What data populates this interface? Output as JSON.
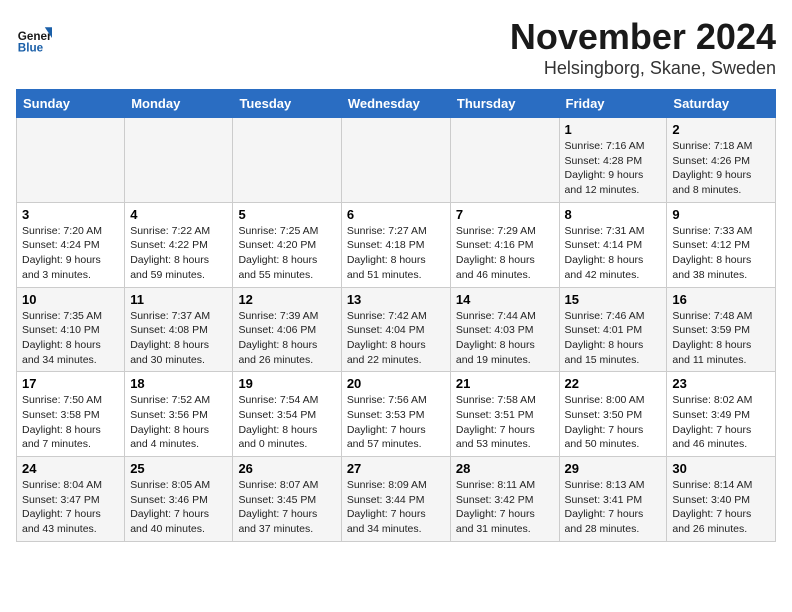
{
  "header": {
    "logo_text_general": "General",
    "logo_text_blue": "Blue",
    "title": "November 2024",
    "subtitle": "Helsingborg, Skane, Sweden"
  },
  "weekdays": [
    "Sunday",
    "Monday",
    "Tuesday",
    "Wednesday",
    "Thursday",
    "Friday",
    "Saturday"
  ],
  "weeks": [
    [
      {
        "day": "",
        "info": ""
      },
      {
        "day": "",
        "info": ""
      },
      {
        "day": "",
        "info": ""
      },
      {
        "day": "",
        "info": ""
      },
      {
        "day": "",
        "info": ""
      },
      {
        "day": "1",
        "info": "Sunrise: 7:16 AM\nSunset: 4:28 PM\nDaylight: 9 hours\nand 12 minutes."
      },
      {
        "day": "2",
        "info": "Sunrise: 7:18 AM\nSunset: 4:26 PM\nDaylight: 9 hours\nand 8 minutes."
      }
    ],
    [
      {
        "day": "3",
        "info": "Sunrise: 7:20 AM\nSunset: 4:24 PM\nDaylight: 9 hours\nand 3 minutes."
      },
      {
        "day": "4",
        "info": "Sunrise: 7:22 AM\nSunset: 4:22 PM\nDaylight: 8 hours\nand 59 minutes."
      },
      {
        "day": "5",
        "info": "Sunrise: 7:25 AM\nSunset: 4:20 PM\nDaylight: 8 hours\nand 55 minutes."
      },
      {
        "day": "6",
        "info": "Sunrise: 7:27 AM\nSunset: 4:18 PM\nDaylight: 8 hours\nand 51 minutes."
      },
      {
        "day": "7",
        "info": "Sunrise: 7:29 AM\nSunset: 4:16 PM\nDaylight: 8 hours\nand 46 minutes."
      },
      {
        "day": "8",
        "info": "Sunrise: 7:31 AM\nSunset: 4:14 PM\nDaylight: 8 hours\nand 42 minutes."
      },
      {
        "day": "9",
        "info": "Sunrise: 7:33 AM\nSunset: 4:12 PM\nDaylight: 8 hours\nand 38 minutes."
      }
    ],
    [
      {
        "day": "10",
        "info": "Sunrise: 7:35 AM\nSunset: 4:10 PM\nDaylight: 8 hours\nand 34 minutes."
      },
      {
        "day": "11",
        "info": "Sunrise: 7:37 AM\nSunset: 4:08 PM\nDaylight: 8 hours\nand 30 minutes."
      },
      {
        "day": "12",
        "info": "Sunrise: 7:39 AM\nSunset: 4:06 PM\nDaylight: 8 hours\nand 26 minutes."
      },
      {
        "day": "13",
        "info": "Sunrise: 7:42 AM\nSunset: 4:04 PM\nDaylight: 8 hours\nand 22 minutes."
      },
      {
        "day": "14",
        "info": "Sunrise: 7:44 AM\nSunset: 4:03 PM\nDaylight: 8 hours\nand 19 minutes."
      },
      {
        "day": "15",
        "info": "Sunrise: 7:46 AM\nSunset: 4:01 PM\nDaylight: 8 hours\nand 15 minutes."
      },
      {
        "day": "16",
        "info": "Sunrise: 7:48 AM\nSunset: 3:59 PM\nDaylight: 8 hours\nand 11 minutes."
      }
    ],
    [
      {
        "day": "17",
        "info": "Sunrise: 7:50 AM\nSunset: 3:58 PM\nDaylight: 8 hours\nand 7 minutes."
      },
      {
        "day": "18",
        "info": "Sunrise: 7:52 AM\nSunset: 3:56 PM\nDaylight: 8 hours\nand 4 minutes."
      },
      {
        "day": "19",
        "info": "Sunrise: 7:54 AM\nSunset: 3:54 PM\nDaylight: 8 hours\nand 0 minutes."
      },
      {
        "day": "20",
        "info": "Sunrise: 7:56 AM\nSunset: 3:53 PM\nDaylight: 7 hours\nand 57 minutes."
      },
      {
        "day": "21",
        "info": "Sunrise: 7:58 AM\nSunset: 3:51 PM\nDaylight: 7 hours\nand 53 minutes."
      },
      {
        "day": "22",
        "info": "Sunrise: 8:00 AM\nSunset: 3:50 PM\nDaylight: 7 hours\nand 50 minutes."
      },
      {
        "day": "23",
        "info": "Sunrise: 8:02 AM\nSunset: 3:49 PM\nDaylight: 7 hours\nand 46 minutes."
      }
    ],
    [
      {
        "day": "24",
        "info": "Sunrise: 8:04 AM\nSunset: 3:47 PM\nDaylight: 7 hours\nand 43 minutes."
      },
      {
        "day": "25",
        "info": "Sunrise: 8:05 AM\nSunset: 3:46 PM\nDaylight: 7 hours\nand 40 minutes."
      },
      {
        "day": "26",
        "info": "Sunrise: 8:07 AM\nSunset: 3:45 PM\nDaylight: 7 hours\nand 37 minutes."
      },
      {
        "day": "27",
        "info": "Sunrise: 8:09 AM\nSunset: 3:44 PM\nDaylight: 7 hours\nand 34 minutes."
      },
      {
        "day": "28",
        "info": "Sunrise: 8:11 AM\nSunset: 3:42 PM\nDaylight: 7 hours\nand 31 minutes."
      },
      {
        "day": "29",
        "info": "Sunrise: 8:13 AM\nSunset: 3:41 PM\nDaylight: 7 hours\nand 28 minutes."
      },
      {
        "day": "30",
        "info": "Sunrise: 8:14 AM\nSunset: 3:40 PM\nDaylight: 7 hours\nand 26 minutes."
      }
    ]
  ]
}
